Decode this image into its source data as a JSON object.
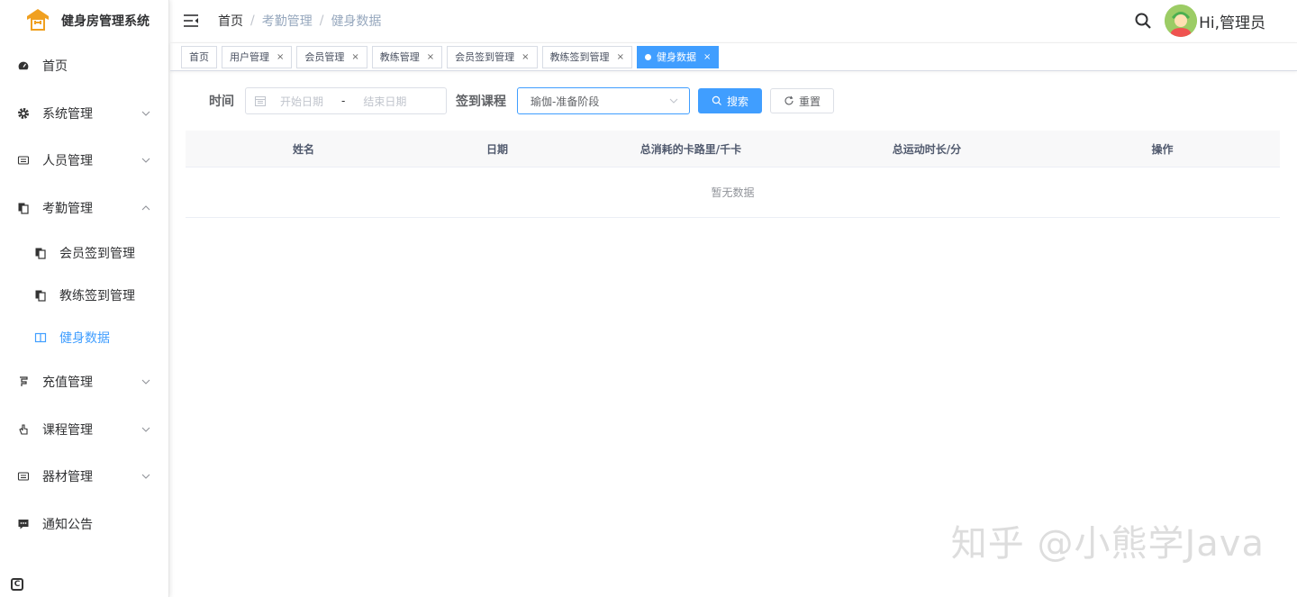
{
  "app": {
    "title": "健身房管理系统",
    "accent_color": "#409eff",
    "logo_color": "#f0a020"
  },
  "sidebar": {
    "items": [
      {
        "label": "首页",
        "icon": "dashboard-icon"
      },
      {
        "label": "系统管理",
        "icon": "gear-icon",
        "expandable": true
      },
      {
        "label": "人员管理",
        "icon": "people-icon",
        "expandable": true
      },
      {
        "label": "考勤管理",
        "icon": "documents-icon",
        "expandable": true,
        "expanded": true,
        "children": [
          {
            "label": "会员签到管理",
            "icon": "documents-icon"
          },
          {
            "label": "教练签到管理",
            "icon": "documents-icon"
          },
          {
            "label": "健身数据",
            "icon": "book-icon",
            "active": true
          }
        ]
      },
      {
        "label": "充值管理",
        "icon": "recharge-icon",
        "expandable": true
      },
      {
        "label": "课程管理",
        "icon": "hand-icon",
        "expandable": true
      },
      {
        "label": "器材管理",
        "icon": "equipment-icon",
        "expandable": true
      },
      {
        "label": "通知公告",
        "icon": "message-icon"
      }
    ]
  },
  "header": {
    "breadcrumb": [
      "首页",
      "考勤管理",
      "健身数据"
    ],
    "greeting": "Hi,管理员"
  },
  "tags": [
    {
      "label": "首页",
      "closable": false
    },
    {
      "label": "用户管理",
      "closable": true
    },
    {
      "label": "会员管理",
      "closable": true
    },
    {
      "label": "教练管理",
      "closable": true
    },
    {
      "label": "会员签到管理",
      "closable": true
    },
    {
      "label": "教练签到管理",
      "closable": true
    },
    {
      "label": "健身数据",
      "closable": true,
      "active": true
    }
  ],
  "filters": {
    "time_label": "时间",
    "start_placeholder": "开始日期",
    "range_separator": "-",
    "end_placeholder": "结束日期",
    "course_label": "签到课程",
    "course_value": "瑜伽-准备阶段",
    "search_label": "搜索",
    "reset_label": "重置"
  },
  "table": {
    "columns": [
      "姓名",
      "日期",
      "总消耗的卡路里/千卡",
      "总运动时长/分",
      "操作"
    ],
    "empty_text": "暂无数据"
  },
  "watermark": "知乎 @小熊学Java"
}
